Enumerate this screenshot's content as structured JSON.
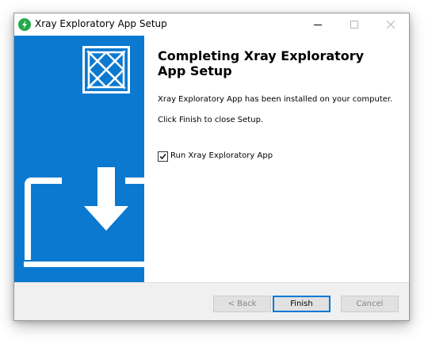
{
  "window": {
    "title": "Xray Exploratory App Setup",
    "controls": {
      "minimize": "minimize",
      "maximize": "maximize",
      "close": "close"
    }
  },
  "main": {
    "heading": "Completing Xray Exploratory App Setup",
    "installed_message": "Xray Exploratory App has been installed on your computer.",
    "finish_message": "Click Finish to close Setup.",
    "run_checkbox": {
      "label": "Run Xray Exploratory App",
      "checked": true
    }
  },
  "footer": {
    "back_label": "< Back",
    "finish_label": "Finish",
    "cancel_label": "Cancel"
  },
  "colors": {
    "side_panel": "#0b79d0",
    "focus_border": "#0078d7",
    "app_icon": "#23a94a"
  }
}
